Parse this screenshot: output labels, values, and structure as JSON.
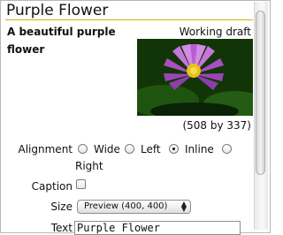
{
  "page": {
    "title": "Purple Flower",
    "subtitle": "A beautiful purple flower",
    "status": "Working draft"
  },
  "image": {
    "description_icon": "purple-water-lily-photo",
    "dimensions": "(508 by 337)"
  },
  "form": {
    "alignment": {
      "label": "Alignment",
      "options": [
        "Wide",
        "Left",
        "Inline",
        "Right"
      ],
      "selected": "Inline"
    },
    "caption": {
      "label": "Caption",
      "checked": false
    },
    "size": {
      "label": "Size",
      "value": "Preview (400, 400)"
    },
    "text": {
      "label": "Text",
      "value": "Purple Flower"
    }
  },
  "colors": {
    "title_rule": "#c8b400",
    "petal": "#c46bd6",
    "foliage": "#173f0c"
  }
}
